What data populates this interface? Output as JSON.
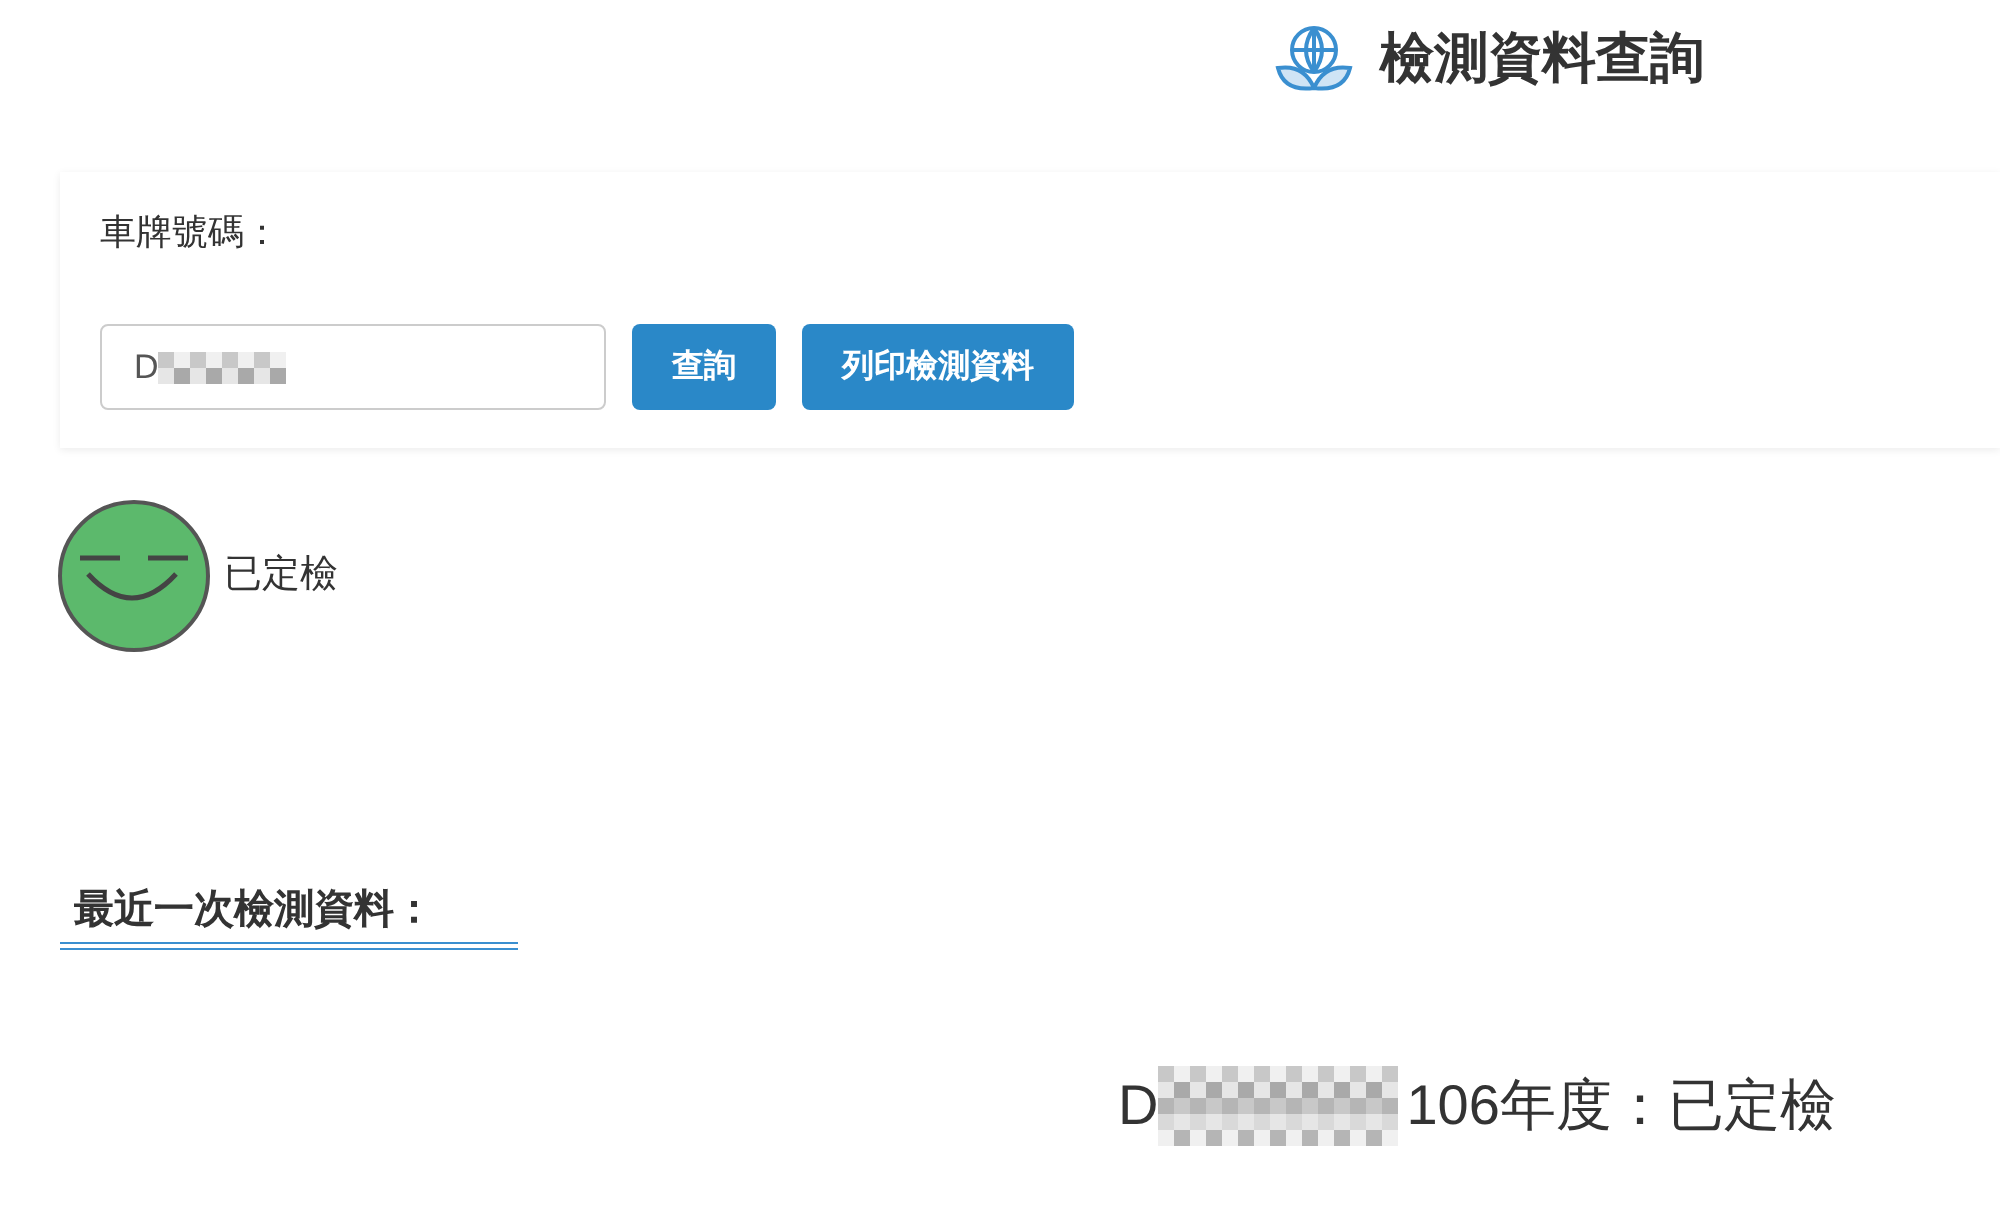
{
  "header": {
    "title": "檢測資料查詢"
  },
  "search": {
    "label": "車牌號碼：",
    "value": "D",
    "buttons": [
      {
        "label": "查詢"
      },
      {
        "label": "列印檢測資料"
      }
    ]
  },
  "status": {
    "kind": "passed",
    "label": "已定檢"
  },
  "latest": {
    "heading": "最近一次檢測資料：",
    "plate": "D",
    "summary": "106年度：已定檢"
  }
}
